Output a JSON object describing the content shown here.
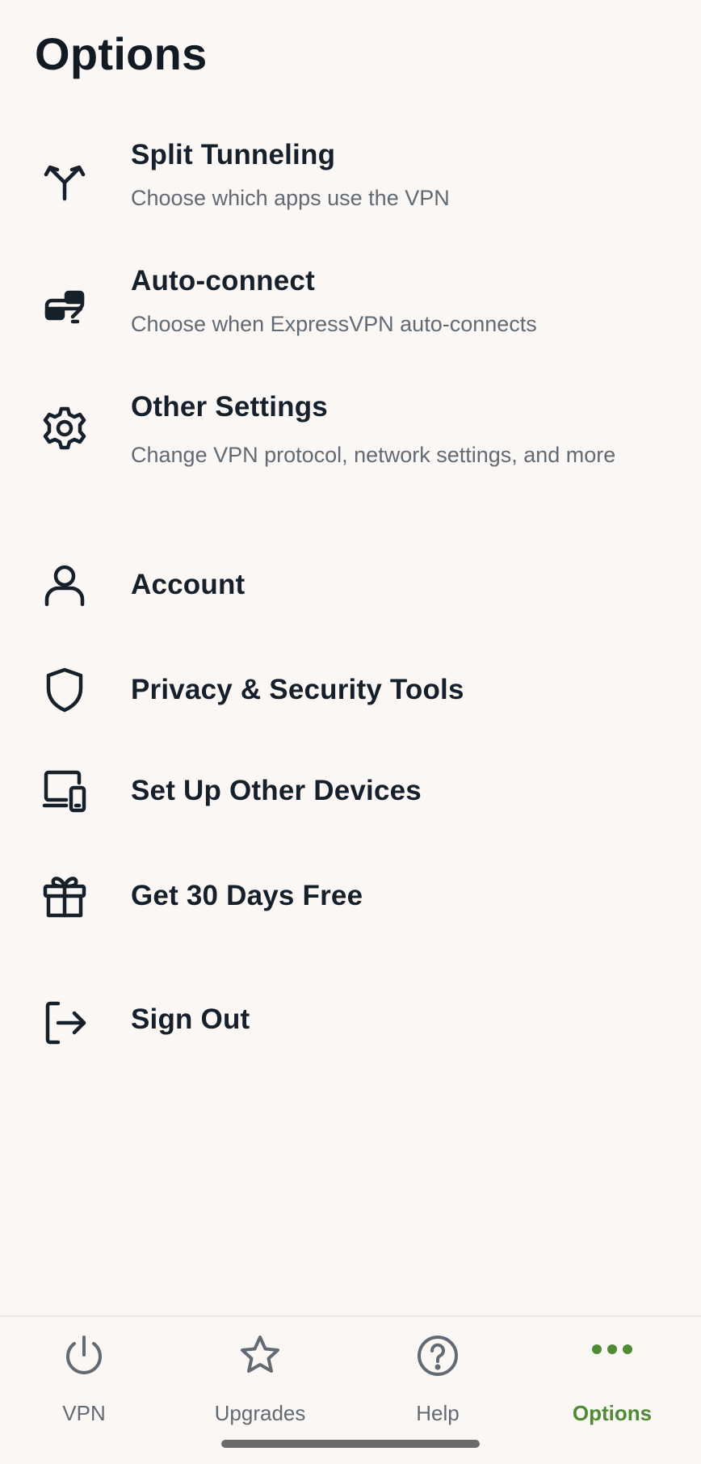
{
  "page": {
    "title": "Options"
  },
  "menu": {
    "items": [
      {
        "id": "split-tunneling",
        "icon": "split-arrows-icon",
        "title": "Split Tunneling",
        "subtitle": "Choose which apps use the VPN"
      },
      {
        "id": "auto-connect",
        "icon": "auto-connect-icon",
        "title": "Auto-connect",
        "subtitle": "Choose when ExpressVPN auto-connects"
      },
      {
        "id": "other-settings",
        "icon": "gear-icon",
        "title": "Other Settings",
        "subtitle": "Change VPN protocol, network settings, and more"
      },
      {
        "id": "account",
        "icon": "person-icon",
        "title": "Account"
      },
      {
        "id": "privacy-security-tools",
        "icon": "shield-icon",
        "title": "Privacy & Security Tools"
      },
      {
        "id": "set-up-other-devices",
        "icon": "devices-icon",
        "title": "Set Up Other Devices"
      },
      {
        "id": "get-30-days-free",
        "icon": "gift-icon",
        "title": "Get 30 Days Free"
      },
      {
        "id": "sign-out",
        "icon": "sign-out-icon",
        "title": "Sign Out"
      }
    ]
  },
  "tabbar": {
    "tabs": [
      {
        "label": "VPN",
        "icon": "power-icon",
        "active": false
      },
      {
        "label": "Upgrades",
        "icon": "star-icon",
        "active": false
      },
      {
        "label": "Help",
        "icon": "question-circle-icon",
        "active": false
      },
      {
        "label": "Options",
        "icon": "more-dots-icon",
        "active": true
      }
    ]
  },
  "colors": {
    "background": "#faf7f5",
    "text_primary": "#16202b",
    "text_secondary": "#626a73",
    "accent_active": "#4f8a34"
  }
}
